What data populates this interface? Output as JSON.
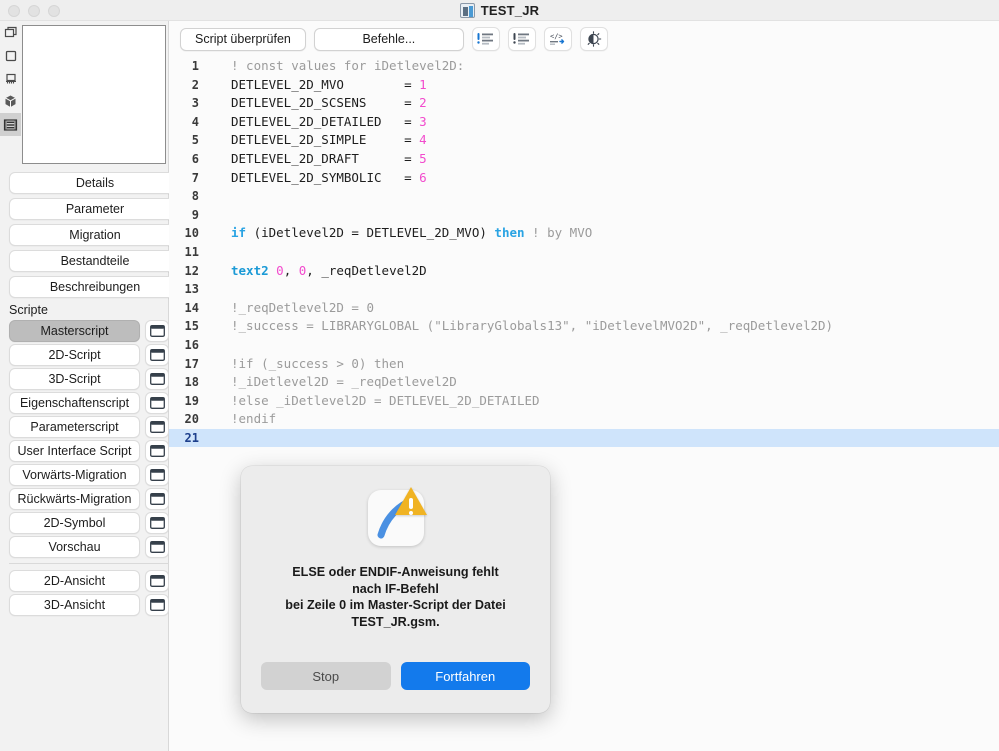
{
  "window": {
    "title": "TEST_JR",
    "doc_icon": "gdl-object-icon",
    "traffic_lights": [
      "close-button",
      "minimize-button",
      "zoom-button"
    ]
  },
  "toolbar": {
    "check_script_label": "Script überprüfen",
    "commands_label": "Befehle...",
    "icons": [
      {
        "name": "warnings-list-icon"
      },
      {
        "name": "errors-list-icon"
      },
      {
        "name": "code-snippet-icon"
      },
      {
        "name": "contrast-icon"
      }
    ]
  },
  "rail": {
    "items": [
      {
        "name": "rail-item-select",
        "selected": false
      },
      {
        "name": "rail-item-shape",
        "selected": false
      },
      {
        "name": "rail-item-stamp",
        "selected": false
      },
      {
        "name": "rail-item-cube",
        "selected": false
      },
      {
        "name": "rail-item-film",
        "selected": true
      }
    ]
  },
  "left_panel": {
    "buttons": [
      {
        "label": "Details"
      },
      {
        "label": "Parameter"
      },
      {
        "label": "Migration"
      },
      {
        "label": "Bestandteile"
      },
      {
        "label": "Beschreibungen"
      }
    ],
    "scripts_section_label": "Scripte",
    "scripts": [
      {
        "label": "Masterscript",
        "selected": true
      },
      {
        "label": "2D-Script",
        "selected": false
      },
      {
        "label": "3D-Script",
        "selected": false
      },
      {
        "label": "Eigenschaftenscript",
        "selected": false
      },
      {
        "label": "Parameterscript",
        "selected": false
      },
      {
        "label": "User Interface Script",
        "selected": false
      },
      {
        "label": "Vorwärts-Migration",
        "selected": false
      },
      {
        "label": "Rückwärts-Migration",
        "selected": false
      },
      {
        "label": "2D-Symbol",
        "selected": false
      },
      {
        "label": "Vorschau",
        "selected": false
      }
    ],
    "views": [
      {
        "label": "2D-Ansicht"
      },
      {
        "label": "3D-Ansicht"
      }
    ]
  },
  "editor": {
    "highlighted_line": 21,
    "lines": [
      {
        "n": "1",
        "tokens": [
          {
            "t": "comment",
            "s": "! const values for iDetlevel2D:"
          }
        ]
      },
      {
        "n": "2",
        "tokens": [
          {
            "t": "plain",
            "s": "DETLEVEL_2D_MVO"
          },
          {
            "t": "plain",
            "s": "        = "
          },
          {
            "t": "num",
            "s": "1"
          }
        ]
      },
      {
        "n": "3",
        "tokens": [
          {
            "t": "plain",
            "s": "DETLEVEL_2D_SCSENS"
          },
          {
            "t": "plain",
            "s": "     = "
          },
          {
            "t": "num",
            "s": "2"
          }
        ]
      },
      {
        "n": "4",
        "tokens": [
          {
            "t": "plain",
            "s": "DETLEVEL_2D_DETAILED"
          },
          {
            "t": "plain",
            "s": "   = "
          },
          {
            "t": "num",
            "s": "3"
          }
        ]
      },
      {
        "n": "5",
        "tokens": [
          {
            "t": "plain",
            "s": "DETLEVEL_2D_SIMPLE"
          },
          {
            "t": "plain",
            "s": "     = "
          },
          {
            "t": "num",
            "s": "4"
          }
        ]
      },
      {
        "n": "6",
        "tokens": [
          {
            "t": "plain",
            "s": "DETLEVEL_2D_DRAFT"
          },
          {
            "t": "plain",
            "s": "      = "
          },
          {
            "t": "num",
            "s": "5"
          }
        ]
      },
      {
        "n": "7",
        "tokens": [
          {
            "t": "plain",
            "s": "DETLEVEL_2D_SYMBOLIC"
          },
          {
            "t": "plain",
            "s": "   = "
          },
          {
            "t": "num",
            "s": "6"
          }
        ]
      },
      {
        "n": "8",
        "tokens": []
      },
      {
        "n": "9",
        "tokens": []
      },
      {
        "n": "10",
        "tokens": [
          {
            "t": "kw",
            "s": "if"
          },
          {
            "t": "plain",
            "s": " (iDetlevel2D = DETLEVEL_2D_MVO) "
          },
          {
            "t": "kw",
            "s": "then"
          },
          {
            "t": "comment",
            "s": " ! by MVO"
          }
        ]
      },
      {
        "n": "11",
        "tokens": []
      },
      {
        "n": "12",
        "tokens": [
          {
            "t": "fn",
            "s": "text2"
          },
          {
            "t": "plain",
            "s": " "
          },
          {
            "t": "num",
            "s": "0"
          },
          {
            "t": "plain",
            "s": ", "
          },
          {
            "t": "num",
            "s": "0"
          },
          {
            "t": "plain",
            "s": ", _reqDetlevel2D"
          }
        ]
      },
      {
        "n": "13",
        "tokens": []
      },
      {
        "n": "14",
        "tokens": [
          {
            "t": "comment",
            "s": "!_reqDetlevel2D = 0"
          }
        ]
      },
      {
        "n": "15",
        "tokens": [
          {
            "t": "comment",
            "s": "!_success = LIBRARYGLOBAL (\"LibraryGlobals13\", \"iDetlevelMVO2D\", _reqDetlevel2D)"
          }
        ]
      },
      {
        "n": "16",
        "tokens": []
      },
      {
        "n": "17",
        "tokens": [
          {
            "t": "comment",
            "s": "!if (_success > 0) then"
          }
        ]
      },
      {
        "n": "18",
        "tokens": [
          {
            "t": "comment",
            "s": "!_iDetlevel2D = _reqDetlevel2D"
          }
        ]
      },
      {
        "n": "19",
        "tokens": [
          {
            "t": "comment",
            "s": "!else _iDetlevel2D = DETLEVEL_2D_DETAILED"
          }
        ]
      },
      {
        "n": "20",
        "tokens": [
          {
            "t": "comment",
            "s": "!endif"
          }
        ]
      },
      {
        "n": "21",
        "tokens": []
      }
    ]
  },
  "dialog": {
    "icon": "gdl-warning-icon",
    "message_lines": [
      "ELSE oder ENDIF-Anweisung fehlt",
      "nach IF-Befehl",
      "bei Zeile 0 im Master-Script der Datei",
      "TEST_JR.gsm."
    ],
    "stop_label": "Stop",
    "continue_label": "Fortfahren"
  },
  "colors": {
    "accent": "#137aec",
    "warning": "#f0b323",
    "highlight_line": "#cfe4fb",
    "keyword": "#29a3e3",
    "number": "#f24bcd",
    "comment": "#9b9b9b"
  }
}
